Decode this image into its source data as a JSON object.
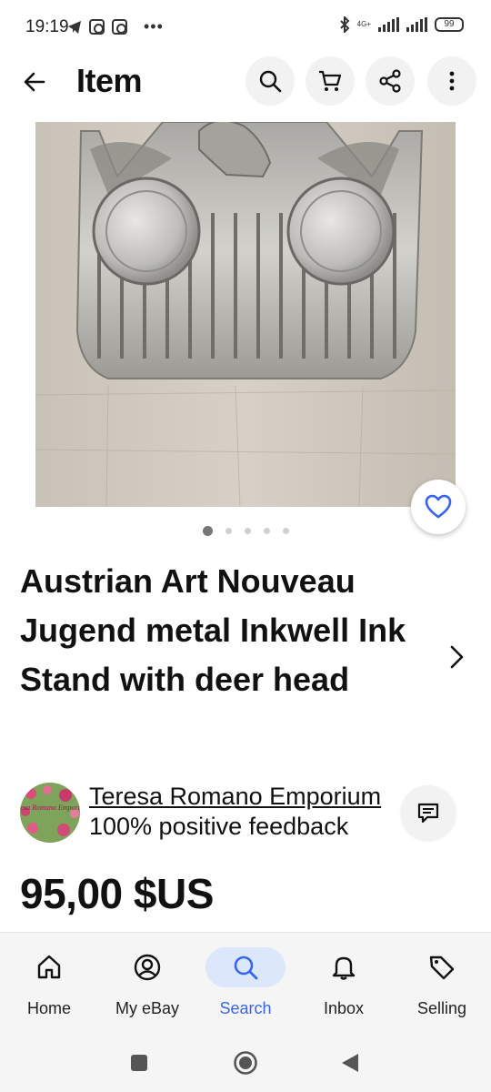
{
  "status_bar": {
    "time": "19:19",
    "network_label": "4G+",
    "battery": "99"
  },
  "app_bar": {
    "title": "Item",
    "icons": [
      "back-arrow-icon",
      "search-icon",
      "cart-icon",
      "share-icon",
      "more-vertical-icon"
    ]
  },
  "gallery": {
    "total_images": 5,
    "current_index": 0,
    "favorited": false
  },
  "item": {
    "title": "Austrian Art Nouveau Jugend metal Inkwell Ink Stand with deer head",
    "price": "95,00 $US"
  },
  "seller": {
    "name": "Teresa Romano Emporium",
    "feedback": "100% positive feedback",
    "avatar_text": "Teresa Romano Emporium"
  },
  "bottom_nav": {
    "items": [
      {
        "label": "Home",
        "icon": "home-icon"
      },
      {
        "label": "My eBay",
        "icon": "account-icon"
      },
      {
        "label": "Search",
        "icon": "search-icon"
      },
      {
        "label": "Inbox",
        "icon": "bell-icon"
      },
      {
        "label": "Selling",
        "icon": "tag-icon"
      }
    ],
    "active": "Search"
  },
  "colors": {
    "accent": "#3665f3",
    "active_pill": "#dce7fb",
    "text": "#111111"
  }
}
